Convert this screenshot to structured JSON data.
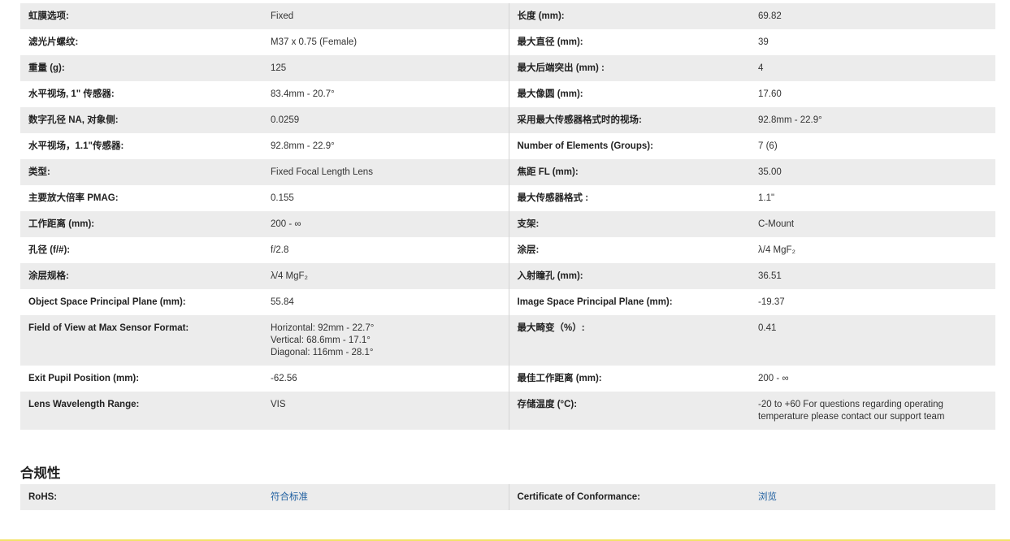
{
  "specs": [
    {
      "l1": "虹膜选项:",
      "v1": "Fixed",
      "l2": "长度 (mm):",
      "v2": "69.82"
    },
    {
      "l1": "滤光片螺纹:",
      "v1": "M37 x 0.75 (Female)",
      "l2": "最大直径 (mm):",
      "v2": "39"
    },
    {
      "l1": "重量 (g):",
      "v1": "125",
      "l2": "最大后端突出 (mm) :",
      "v2": "4"
    },
    {
      "l1": "水平视场, 1\" 传感器:",
      "v1": "83.4mm - 20.7°",
      "l2": "最大像圆 (mm):",
      "v2": "17.60"
    },
    {
      "l1": "数字孔径 NA, 对象侧:",
      "v1": "0.0259",
      "l2": "采用最大传感器格式时的视场:",
      "v2": "92.8mm - 22.9°"
    },
    {
      "l1": "水平视场，1.1\"传感器:",
      "v1": "92.8mm - 22.9°",
      "l2": "Number of Elements (Groups):",
      "v2": "7 (6)"
    },
    {
      "l1": "类型:",
      "v1": "Fixed Focal Length Lens",
      "l2": "焦距 FL (mm):",
      "v2": "35.00"
    },
    {
      "l1": "主要放大倍率 PMAG:",
      "v1": "0.155",
      "l2": "最大传感器格式 :",
      "v2": "1.1\""
    },
    {
      "l1": "工作距离 (mm):",
      "v1": "200 - ∞",
      "l2": "支架:",
      "v2": "C-Mount"
    },
    {
      "l1": "孔径 (f/#):",
      "v1": "f/2.8",
      "l2": "涂层:",
      "v2": "λ/4 MgF₂"
    },
    {
      "l1": "涂层规格:",
      "v1": "λ/4 MgF₂",
      "l2": "入射瞳孔 (mm):",
      "v2": "36.51"
    },
    {
      "l1": "Object Space Principal Plane (mm):",
      "v1": "55.84",
      "l2": "Image Space Principal Plane (mm):",
      "v2": "-19.37"
    },
    {
      "l1": "Field of View at Max Sensor Format:",
      "v1": "Horizontal: 92mm - 22.7°\nVertical: 68.6mm - 17.1°\nDiagonal: 116mm - 28.1°",
      "l2": "最大畸变（%）:",
      "v2": "0.41"
    },
    {
      "l1": "Exit Pupil Position (mm):",
      "v1": "-62.56",
      "l2": "最佳工作距离 (mm):",
      "v2": "200 - ∞"
    },
    {
      "l1": "Lens Wavelength Range:",
      "v1": "VIS",
      "l2": "存储温度 (°C):",
      "v2": "-20 to +60 For questions regarding operating temperature please contact our support team"
    }
  ],
  "compliance": {
    "title": "合规性",
    "rohs_label": "RoHS:",
    "rohs_link": "符合标准",
    "coc_label": "Certificate of Conformance:",
    "coc_link": "浏览"
  }
}
